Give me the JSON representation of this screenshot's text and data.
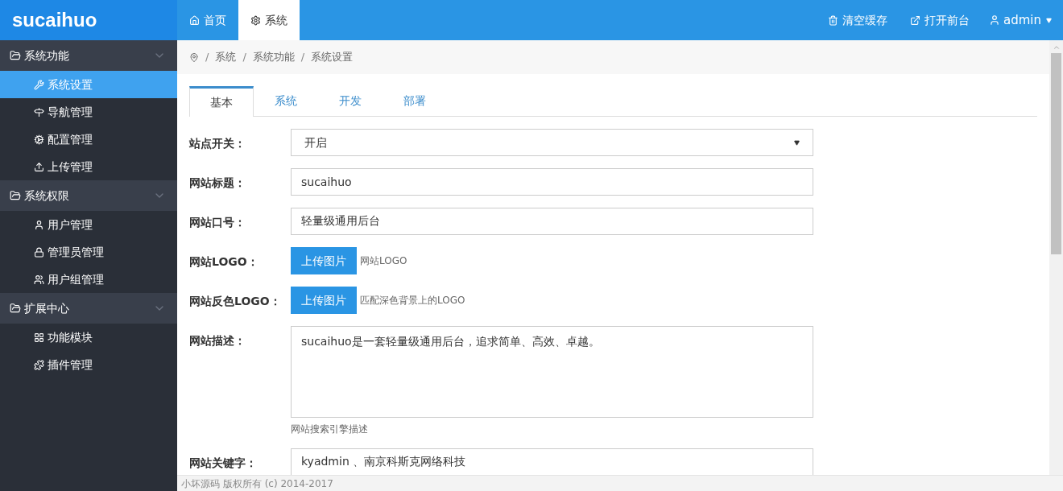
{
  "header": {
    "brand": "sucaihuo",
    "nav": [
      {
        "label": "首页",
        "selected": false
      },
      {
        "label": "系统",
        "selected": true
      }
    ],
    "actions": [
      {
        "label": "清空缓存"
      },
      {
        "label": "打开前台"
      }
    ],
    "user": {
      "name": "admin"
    }
  },
  "sidebar": [
    {
      "label": "系统功能",
      "items": [
        {
          "label": "系统设置",
          "selected": true
        },
        {
          "label": "导航管理",
          "selected": false
        },
        {
          "label": "配置管理",
          "selected": false
        },
        {
          "label": "上传管理",
          "selected": false
        }
      ]
    },
    {
      "label": "系统权限",
      "items": [
        {
          "label": "用户管理",
          "selected": false
        },
        {
          "label": "管理员管理",
          "selected": false
        },
        {
          "label": "用户组管理",
          "selected": false
        }
      ]
    },
    {
      "label": "扩展中心",
      "items": [
        {
          "label": "功能模块",
          "selected": false
        },
        {
          "label": "插件管理",
          "selected": false
        }
      ]
    }
  ],
  "breadcrumb": [
    {
      "separator": "/",
      "label": "系统"
    },
    {
      "separator": "/",
      "label": "系统功能"
    },
    {
      "separator": "/",
      "label": "系统设置"
    }
  ],
  "tabs": [
    {
      "label": "基本",
      "selected": true
    },
    {
      "label": "系统",
      "selected": false
    },
    {
      "label": "开发",
      "selected": false
    },
    {
      "label": "部署",
      "selected": false
    }
  ],
  "form": [
    {
      "kind": "select",
      "label": "站点开关：",
      "value": "开启"
    },
    {
      "kind": "text",
      "label": "网站标题：",
      "value": "sucaihuo"
    },
    {
      "kind": "text",
      "label": "网站口号：",
      "value": "轻量级通用后台"
    },
    {
      "kind": "upload",
      "label": "网站LOGO：",
      "button": "上传图片",
      "hint": "网站LOGO"
    },
    {
      "kind": "upload",
      "label": "网站反色LOGO：",
      "button": "上传图片",
      "hint": "匹配深色背景上的LOGO"
    },
    {
      "kind": "textarea",
      "label": "网站描述：",
      "value": "sucaihuo是一套轻量级通用后台，追求简单、高效、卓越。",
      "hint": "网站搜索引擎描述"
    },
    {
      "kind": "text",
      "label": "网站关键字：",
      "value": "kyadmin 、南京科斯克网络科技"
    }
  ],
  "footer": "小坏源码 版权所有 (c) 2014-2017"
}
